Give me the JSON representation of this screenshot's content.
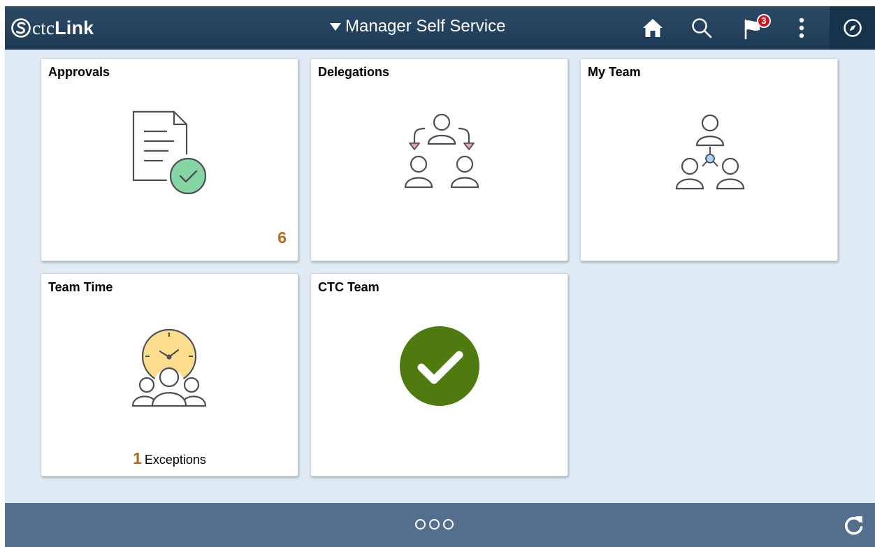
{
  "header": {
    "logo_prefix": "ctc",
    "logo_bold": "Link",
    "title": "Manager Self Service",
    "notification_count": "3",
    "colors": {
      "bar": "#1d3a55",
      "nav_button": "#17324b",
      "badge": "#d3121b"
    },
    "icons": [
      "home-icon",
      "search-icon",
      "flag-icon",
      "more-vertical-icon",
      "navigator-compass-icon"
    ]
  },
  "tiles": [
    {
      "title": "Approvals",
      "count": "6",
      "icon": "approval-document-check-icon"
    },
    {
      "title": "Delegations",
      "icon": "delegation-people-icon"
    },
    {
      "title": "My Team",
      "icon": "team-hierarchy-icon"
    },
    {
      "title": "Team Time",
      "count": "1",
      "count_label": "Exceptions",
      "icon": "team-clock-icon"
    },
    {
      "title": "CTC Team",
      "icon": "green-checkmark-icon",
      "color": "#4e7a0f"
    }
  ],
  "footer": {
    "pages": 3,
    "icons": [
      "page-dots-icon",
      "refresh-icon"
    ],
    "color": "#536f8d"
  }
}
